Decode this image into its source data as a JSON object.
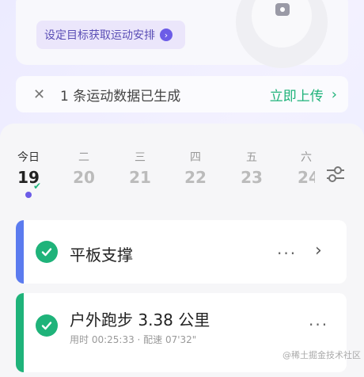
{
  "goal": {
    "label": "设定目标获取运动安排",
    "arrow": "›"
  },
  "notice": {
    "close": "✕",
    "message": "1 条运动数据已生成",
    "action": "立即上传",
    "chevron": "›"
  },
  "days": [
    {
      "weekday": "今日",
      "date": "19",
      "today": true
    },
    {
      "weekday": "二",
      "date": "20"
    },
    {
      "weekday": "三",
      "date": "21"
    },
    {
      "weekday": "四",
      "date": "22"
    },
    {
      "weekday": "五",
      "date": "23"
    },
    {
      "weekday": "六",
      "date": "24"
    }
  ],
  "activities": [
    {
      "title": "平板支撑",
      "more": "···",
      "chevron": "›",
      "accent": "#5b7bef"
    },
    {
      "title": "户外跑步 3.38 公里",
      "meta": "用时 00:25:33 · 配速 07'32\"",
      "more": "···",
      "accent": "#1fb37a"
    }
  ],
  "watermark": "@稀土掘金技术社区",
  "colors": {
    "purple": "#6c5ce7",
    "green": "#1fb37a",
    "blue": "#5b7bef"
  }
}
